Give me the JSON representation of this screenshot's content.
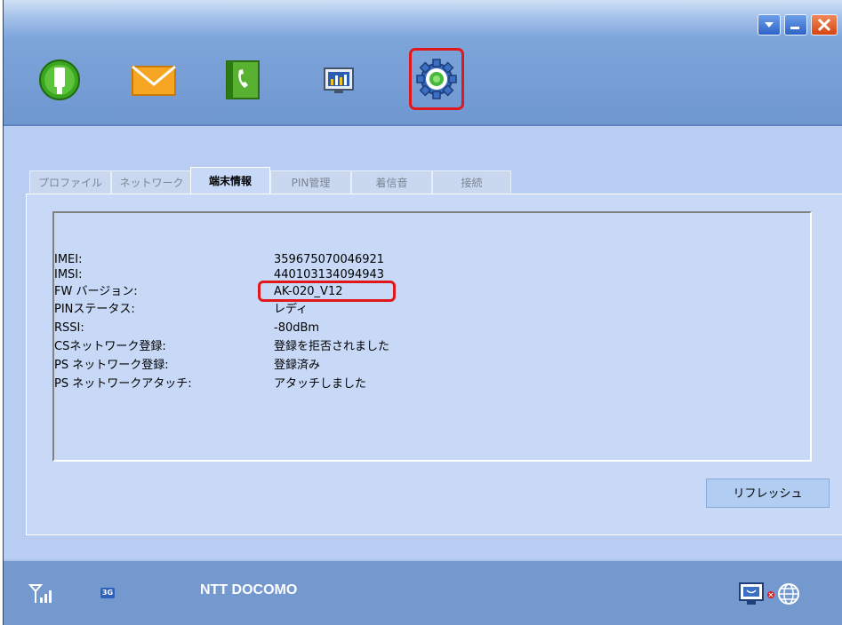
{
  "window": {
    "min_icon": "chevron-down",
    "max_icon": "restore",
    "close_icon": "x"
  },
  "toolbar": {
    "items": [
      {
        "name": "usb-icon"
      },
      {
        "name": "mail-icon"
      },
      {
        "name": "phone-icon"
      },
      {
        "name": "stats-icon"
      },
      {
        "name": "settings-icon",
        "selected": true
      }
    ]
  },
  "tabs": [
    {
      "label": "プロファイル"
    },
    {
      "label": "ネットワーク"
    },
    {
      "label": "端末情報",
      "active": true
    },
    {
      "label": "PIN管理"
    },
    {
      "label": "着信音"
    },
    {
      "label": "接続"
    }
  ],
  "device_info": {
    "rows": [
      {
        "label": "IMEI:",
        "value": "359675070046921"
      },
      {
        "label": "IMSI:",
        "value": "440103134094943"
      },
      {
        "label": "FW バージョン:",
        "value": "AK-020_V12"
      },
      {
        "label": "PINステータス:",
        "value": "レディ"
      },
      {
        "label": "RSSI:",
        "value": "-80dBm"
      },
      {
        "label": "CSネットワーク登録:",
        "value": "登録を拒否されました"
      },
      {
        "label": "PS ネットワーク登録:",
        "value": "登録済み"
      },
      {
        "label": "PS ネットワークアタッチ:",
        "value": "アタッチしました"
      }
    ]
  },
  "refresh_label": "リフレッシュ",
  "status": {
    "network_type": "3G",
    "operator": "NTT DOCOMO"
  },
  "colors": {
    "highlight": "#e0181b",
    "window_bg": "#b8cdf1",
    "status_bar": "#7399cf"
  }
}
